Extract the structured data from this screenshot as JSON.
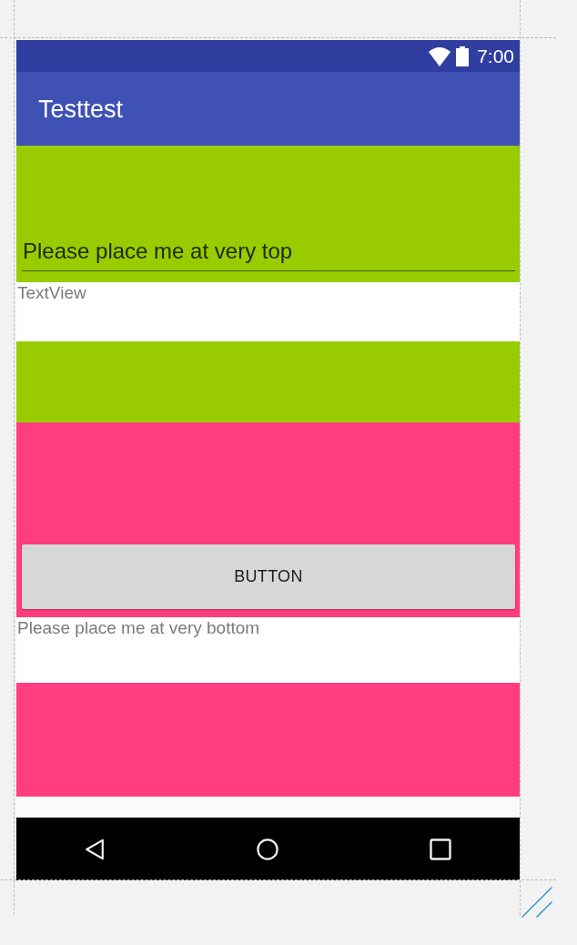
{
  "status_bar": {
    "time": "7:00"
  },
  "app_bar": {
    "title": "Testtest"
  },
  "panels": [
    {
      "color": "#99cc00",
      "items": [
        {
          "kind": "edit_text",
          "value": "Please place me at very top"
        },
        {
          "kind": "text_view",
          "text": "TextView"
        }
      ]
    },
    {
      "color": "#ff3d7f",
      "items": [
        {
          "kind": "button",
          "label": "BUTTON"
        },
        {
          "kind": "text_view",
          "text": "Please place me at very bottom"
        }
      ]
    }
  ]
}
